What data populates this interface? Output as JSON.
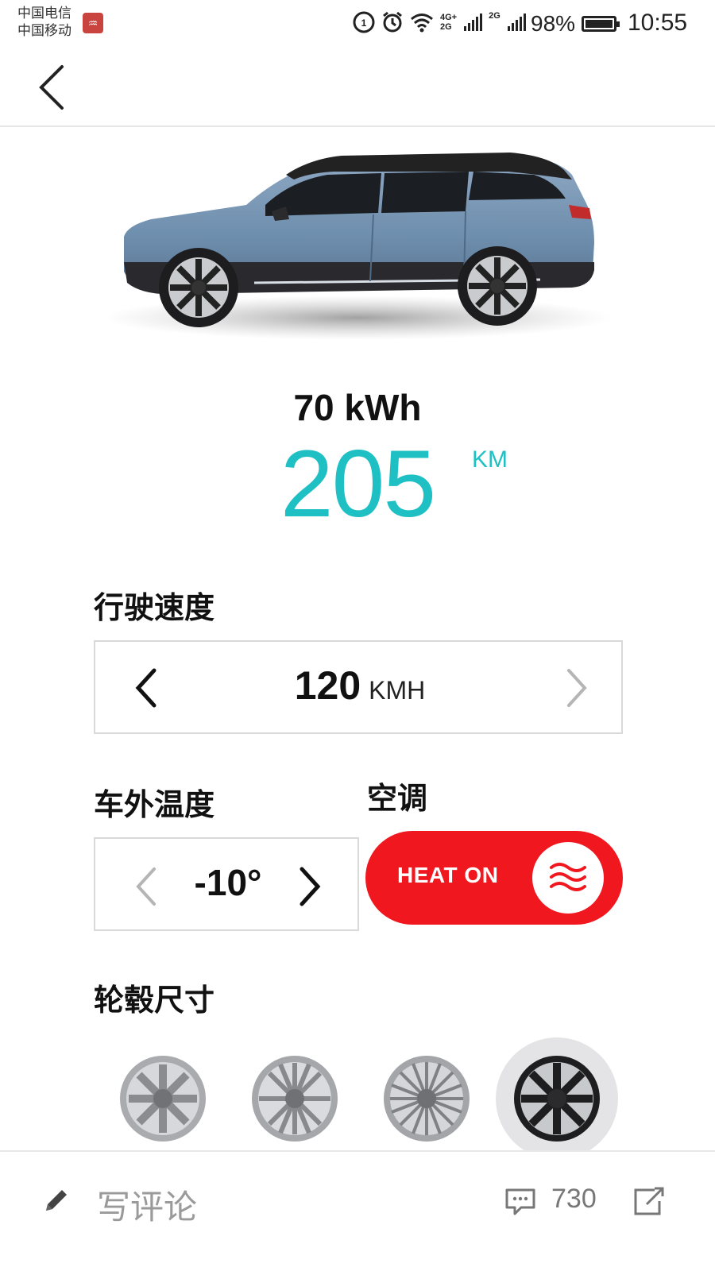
{
  "status_bar": {
    "carriers": [
      "中国电信",
      "中国移动"
    ],
    "battery_percent": "98%",
    "time": "10:55",
    "network_labels": [
      "4G+",
      "2G",
      "2G"
    ],
    "icons": [
      "hd-icon",
      "alarm-icon",
      "wifi-icon",
      "signal-icon",
      "signal-icon",
      "battery-icon"
    ]
  },
  "header": {
    "back_icon": "chevron-left-icon"
  },
  "vehicle": {
    "battery_capacity": "70 kWh",
    "range_value": "205",
    "range_unit": "KM",
    "body_color": "#6f8fae"
  },
  "speed": {
    "label": "行驶速度",
    "value": "120",
    "unit": "KMH"
  },
  "temperature": {
    "label": "车外温度",
    "value": "-10°"
  },
  "climate": {
    "label": "空调",
    "button_label": "HEAT ON",
    "color": "#f0171f",
    "icon": "heat-waves-icon"
  },
  "wheels": {
    "label": "轮毂尺寸",
    "options_count": 4,
    "selected_index": 3
  },
  "bottom_bar": {
    "comment_placeholder": "写评论",
    "comment_count": "730",
    "icons": [
      "pencil-icon",
      "comment-icon",
      "share-icon"
    ]
  },
  "colors": {
    "accent": "#1ec0c4",
    "heat": "#f0171f"
  }
}
